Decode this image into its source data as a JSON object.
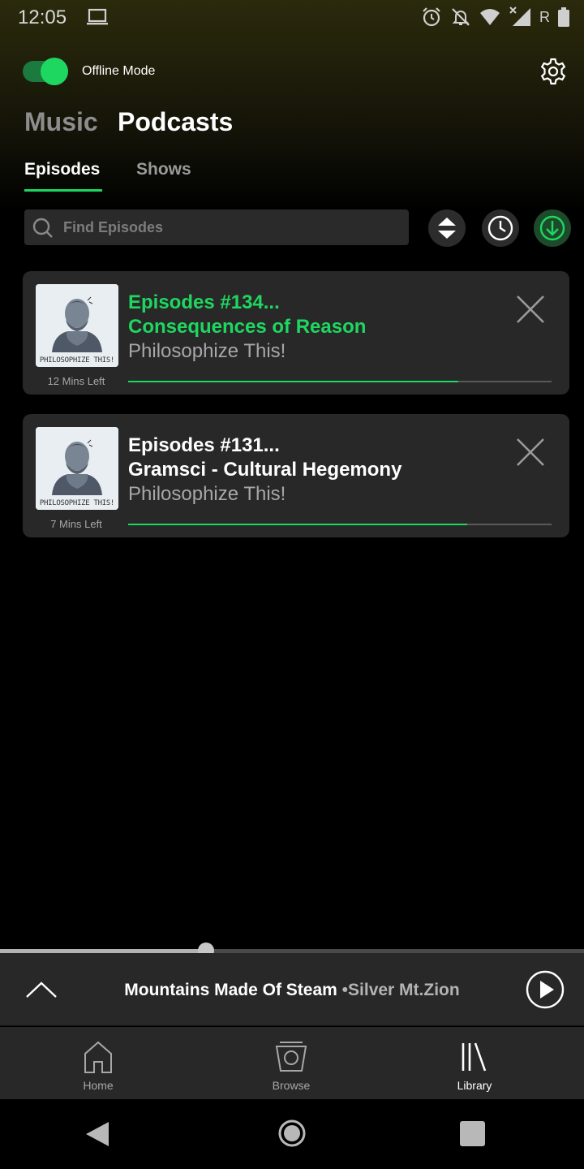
{
  "status_bar": {
    "time": "12:05",
    "carrier_letter": "R",
    "icons": [
      "laptop-icon",
      "alarm-icon",
      "notifications-off-icon",
      "wifi-icon",
      "signal-icon",
      "battery-icon"
    ]
  },
  "header": {
    "offline_mode_label": "Offline Mode",
    "offline_mode_on": true,
    "settings_icon": "gear-icon"
  },
  "sections": {
    "music": "Music",
    "podcasts": "Podcasts",
    "active": "podcasts"
  },
  "subtabs": {
    "episodes": "Episodes",
    "shows": "Shows",
    "active": "episodes"
  },
  "search": {
    "placeholder": "Find Episodes",
    "value": ""
  },
  "filters": {
    "sort_icon": "sort-icon",
    "recent_icon": "clock-icon",
    "downloaded_icon": "download-icon"
  },
  "episodes": [
    {
      "title_line1": "Episodes #134...",
      "title_line2": "Consequences of Reason",
      "show": "Philosophize This!",
      "cover_caption": "PHILOSOPHIZE THIS!",
      "time_left": "12 Mins  Left",
      "progress": 0.78,
      "now_playing": true
    },
    {
      "title_line1": "Episodes #131...",
      "title_line2": "Gramsci -  Cultural Hegemony",
      "show": "Philosophize This!",
      "cover_caption": "PHILOSOPHIZE THIS!",
      "time_left": "7 Mins Left",
      "progress": 0.8,
      "now_playing": false
    }
  ],
  "now_playing": {
    "title": "Mountains Made Of Steam",
    "separator": "•",
    "artist": "Silver Mt.Zion",
    "progress": 0.353
  },
  "bottom_nav": {
    "home": "Home",
    "browse": "Browse",
    "library": "Library",
    "active": "library"
  },
  "colors": {
    "accent": "#1ed760",
    "card_bg": "#282828",
    "secondary_text": "#a7a7a7"
  }
}
